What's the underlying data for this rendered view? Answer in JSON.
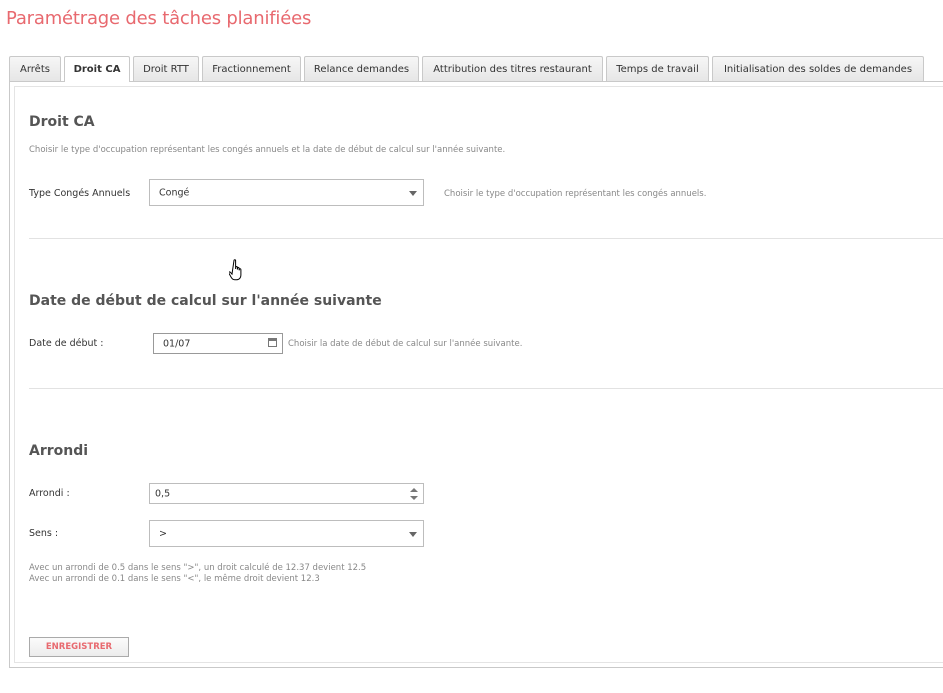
{
  "page": {
    "title": "Paramétrage des tâches planifiées"
  },
  "tabs": [
    {
      "label": "Arrêts",
      "active": false
    },
    {
      "label": "Droit CA",
      "active": true
    },
    {
      "label": "Droit RTT",
      "active": false
    },
    {
      "label": "Fractionnement",
      "active": false
    },
    {
      "label": "Relance demandes",
      "active": false
    },
    {
      "label": "Attribution des titres restaurant",
      "active": false
    },
    {
      "label": "Temps de travail",
      "active": false
    },
    {
      "label": "Initialisation des soldes de demandes",
      "active": false
    }
  ],
  "droit_ca": {
    "title": "Droit CA",
    "description": "Choisir le type d'occupation représentant les congés annuels et la date de début de calcul sur l'année suivante.",
    "type_label": "Type Congés Annuels",
    "type_value": "Congé",
    "type_hint": "Choisir le type d'occupation représentant les congés annuels."
  },
  "date_debut": {
    "title": "Date de début de calcul sur l'année suivante",
    "label": "Date de début :",
    "value": "01/07",
    "hint": "Choisir la date de début de calcul sur l'année suivante."
  },
  "arrondi": {
    "title": "Arrondi",
    "arrondi_label": "Arrondi :",
    "arrondi_value": "0,5",
    "sens_label": "Sens :",
    "sens_value": ">",
    "note_line1": "Avec un arrondi de 0.5 dans le sens \">\", un droit calculé de 12.37 devient 12.5",
    "note_line2": "Avec un arrondi de 0.1 dans le sens \"<\", le même droit devient 12.3"
  },
  "actions": {
    "save_label": "ENREGISTRER"
  },
  "colors": {
    "accent": "#e8696f",
    "border": "#c9c9c9"
  }
}
